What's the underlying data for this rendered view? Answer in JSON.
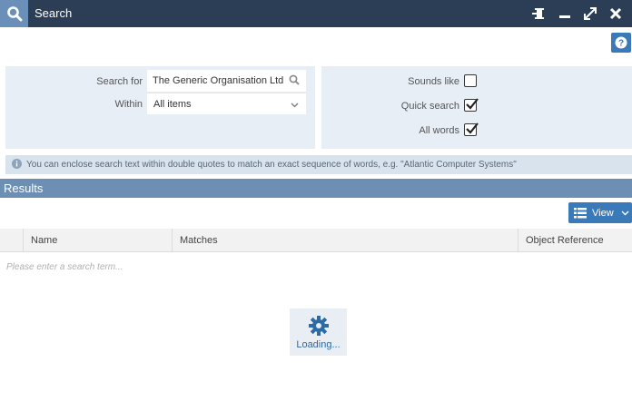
{
  "window": {
    "title": "Search",
    "icons": [
      "search-icon",
      "pin-icon",
      "minimize-icon",
      "maximize-icon",
      "close-icon",
      "help-icon"
    ]
  },
  "search_form": {
    "search_for_label": "Search for",
    "search_for_value": "The Generic Organisation Ltd",
    "within_label": "Within",
    "within_value": "All items"
  },
  "options": {
    "sounds_like_label": "Sounds like",
    "sounds_like_checked": false,
    "quick_search_label": "Quick search",
    "quick_search_checked": true,
    "all_words_label": "All words",
    "all_words_checked": true
  },
  "info": {
    "text": "You can enclose search text within double quotes to match an exact sequence of words, e.g. \"Atlantic Computer Systems\""
  },
  "results": {
    "title": "Results",
    "view_label": "View",
    "columns": [
      "Name",
      "Matches",
      "Object Reference"
    ],
    "empty_text": "Please enter a search term...",
    "loading_text": "Loading..."
  },
  "colors": {
    "titlebar": "#2c3e55",
    "accent": "#3a7ab8",
    "results_bar": "#6c8fb3",
    "panel": "#e7eef6"
  }
}
